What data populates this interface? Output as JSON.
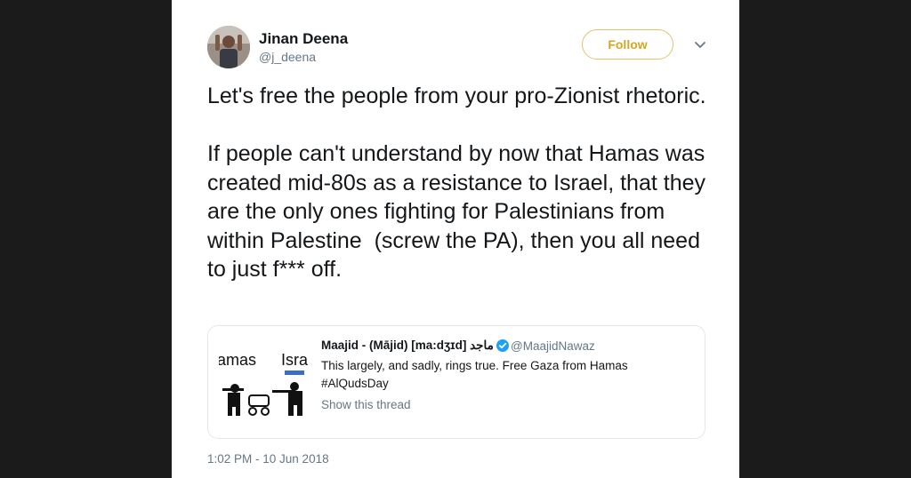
{
  "author": {
    "name": "Jinan Deena",
    "handle": "@j_deena"
  },
  "follow_label": "Follow",
  "tweet_text": "Let's free the people from your pro-Zionist rhetoric.\n\nIf people can't understand by now that Hamas was created mid-80s as a resistance to Israel, that they are the only ones fighting for Palestinians from within Palestine  (screw the PA), then you all need to just f*** off.",
  "quoted": {
    "name": "Maajid - (Mājid) [ma:dʒɪd] ماجد",
    "handle": "@MaajidNawaz",
    "text": "This largely, and sadly, rings true. Free Gaza from Hamas #AlQudsDay",
    "show_thread": "Show this thread",
    "image_labels": [
      "amas",
      "Isra"
    ]
  },
  "timestamp": "1:02 PM - 10 Jun 2018",
  "colors": {
    "follow_accent": "#d6a621",
    "muted": "#657786",
    "verified": "#1da1f2"
  },
  "icons": [
    "chevron-down-icon",
    "verified-badge-icon"
  ]
}
